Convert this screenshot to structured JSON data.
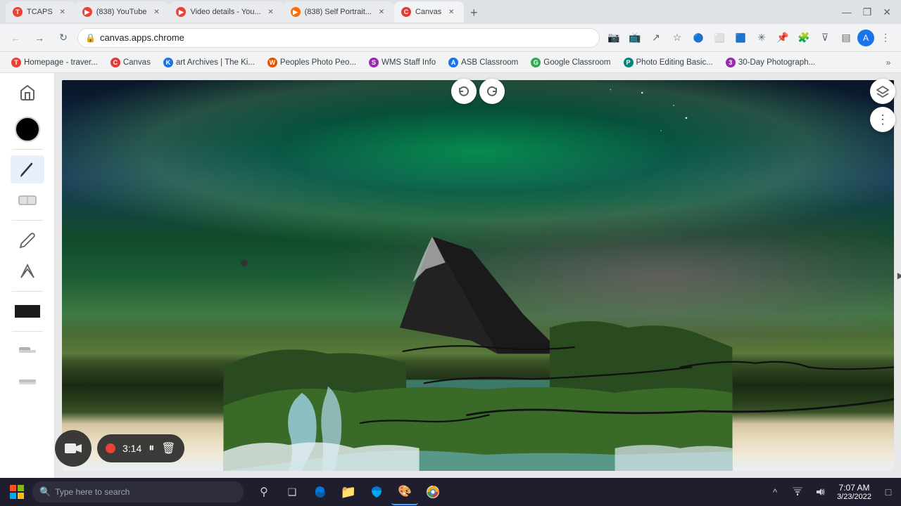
{
  "browser": {
    "tabs": [
      {
        "id": "tcaps",
        "title": "TCAPS",
        "favicon_type": "red",
        "favicon_letter": "T",
        "active": false
      },
      {
        "id": "youtube1",
        "title": "(838) YouTube",
        "favicon_type": "red",
        "favicon_letter": "▶",
        "active": false
      },
      {
        "id": "video_details",
        "title": "Video details - You...",
        "favicon_type": "red",
        "favicon_letter": "▶",
        "active": false
      },
      {
        "id": "self_portrait",
        "title": "(838) Self Portrait...",
        "favicon_type": "orange",
        "favicon_letter": "▶",
        "active": false
      },
      {
        "id": "canvas",
        "title": "Canvas",
        "favicon_type": "canvas",
        "favicon_letter": "C",
        "active": true
      }
    ],
    "address": "canvas.apps.chrome",
    "bookmarks": [
      {
        "id": "homepage",
        "label": "Homepage - traver...",
        "favicon_type": "red",
        "favicon_letter": "T"
      },
      {
        "id": "canvas_bm",
        "label": "Canvas",
        "favicon_type": "canvas",
        "favicon_letter": "C"
      },
      {
        "id": "art_archives",
        "label": "art Archives | The Ki...",
        "favicon_type": "blue",
        "favicon_letter": "K"
      },
      {
        "id": "peoples_photo",
        "label": "Peoples Photo Peo...",
        "favicon_type": "orange",
        "favicon_letter": "W"
      },
      {
        "id": "wms_staff",
        "label": "WMS Staff Info",
        "favicon_type": "purple",
        "favicon_letter": "S"
      },
      {
        "id": "asb_classroom",
        "label": "ASB Classroom",
        "favicon_type": "blue",
        "favicon_letter": "A"
      },
      {
        "id": "google_classroom",
        "label": "Google Classroom",
        "favicon_type": "green",
        "favicon_letter": "G"
      },
      {
        "id": "photo_editing",
        "label": "Photo Editing Basic...",
        "favicon_type": "teal",
        "favicon_letter": "P"
      },
      {
        "id": "day_photography",
        "label": "30-Day Photograph...",
        "favicon_type": "purple",
        "favicon_letter": "3"
      }
    ]
  },
  "canvas_app": {
    "undo_label": "↩",
    "redo_label": "↪",
    "layers_icon": "⊕",
    "more_icon": "⋮",
    "recording": {
      "time": "3:14",
      "cam_icon": "📷",
      "pause_icon": "⏸",
      "delete_icon": "🗑"
    }
  },
  "toolbar": {
    "home_icon": "⌂",
    "color": "#000000",
    "tools": [
      {
        "id": "brush",
        "label": "Brush"
      },
      {
        "id": "eraser",
        "label": "Eraser"
      },
      {
        "id": "pencil",
        "label": "Pencil"
      },
      {
        "id": "calligraphy",
        "label": "Calligraphy"
      },
      {
        "id": "fill",
        "label": "Fill"
      }
    ]
  },
  "taskbar": {
    "start_icon": "⊞",
    "search_placeholder": "Type here to search",
    "center_icons": [
      {
        "id": "search",
        "icon": "⚲"
      },
      {
        "id": "task-view",
        "icon": "❑"
      },
      {
        "id": "edge",
        "icon": "e"
      },
      {
        "id": "files",
        "icon": "📁"
      },
      {
        "id": "edge2",
        "icon": "🌊"
      },
      {
        "id": "canvas-app",
        "icon": "🎨"
      },
      {
        "id": "chrome",
        "icon": "◎"
      }
    ],
    "time": "7:07 AM",
    "date": "3/23/2022"
  }
}
